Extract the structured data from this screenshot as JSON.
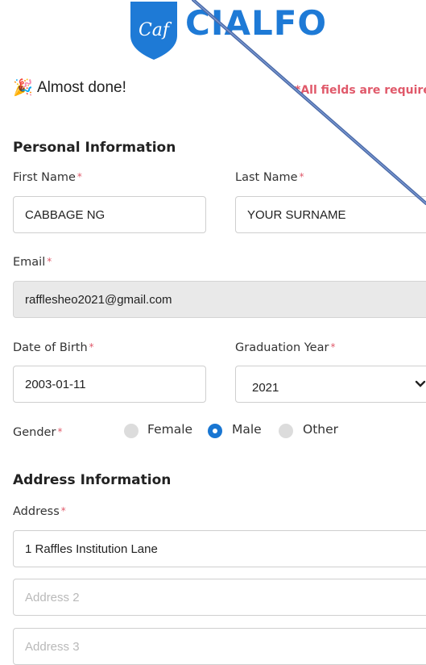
{
  "brand": {
    "name": "CIALFO",
    "shield_text": "Caf",
    "color": "#1e7ad6"
  },
  "header": {
    "title": "Almost done!",
    "emoji": "🎉",
    "required_note": "*All fields are required"
  },
  "personal": {
    "heading": "Personal Information",
    "first_name": {
      "label": "First Name",
      "value": "CABBAGE NG"
    },
    "last_name": {
      "label": "Last Name",
      "value": "YOUR SURNAME"
    },
    "email": {
      "label": "Email",
      "value": "rafflesheo2021@gmail.com"
    },
    "dob": {
      "label": "Date of Birth",
      "value": "2003-01-11"
    },
    "grad_year": {
      "label": "Graduation Year",
      "value": "2021"
    },
    "gender": {
      "label": "Gender",
      "options": [
        "Female",
        "Male",
        "Other"
      ],
      "selected": "Male"
    }
  },
  "address": {
    "heading": "Address Information",
    "label": "Address",
    "line1": {
      "value": "1 Raffles Institution Lane"
    },
    "line2": {
      "placeholder": "Address 2"
    },
    "line3": {
      "placeholder": "Address 3"
    }
  },
  "required_mark": "*",
  "icons": {
    "select": "chevron-down-icon",
    "overlay": "diagonal-pen-line"
  }
}
